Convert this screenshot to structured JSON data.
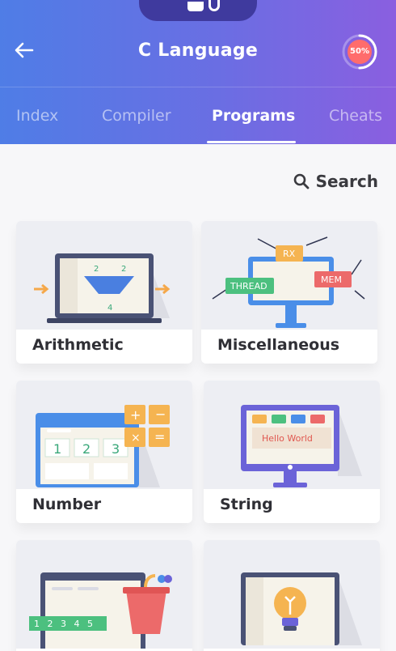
{
  "header": {
    "title": "C Language",
    "progress": {
      "value": 0.5,
      "label": "50%"
    }
  },
  "tabs": [
    {
      "label": "Index",
      "active": false
    },
    {
      "label": "Compiler",
      "active": false
    },
    {
      "label": "Programs",
      "active": true
    },
    {
      "label": "Cheats",
      "active": false
    }
  ],
  "search": {
    "label": "Search"
  },
  "cards": [
    {
      "name": "Arithmetic",
      "icon": "arithmetic-illustration",
      "art_text": [
        "2",
        "2",
        "4"
      ]
    },
    {
      "name": "Miscellaneous",
      "icon": "miscellaneous-illustration",
      "art_text": [
        "RX",
        "THREAD",
        "MEM"
      ]
    },
    {
      "name": "Number",
      "icon": "number-illustration",
      "art_text": [
        "1",
        "2",
        "3"
      ]
    },
    {
      "name": "String",
      "icon": "string-illustration",
      "art_text": [
        "Hello World"
      ]
    },
    {
      "name": "",
      "icon": "array-illustration",
      "art_text": [
        "1",
        "2",
        "3",
        "4",
        "5"
      ]
    },
    {
      "name": "",
      "icon": "idea-illustration",
      "art_text": []
    }
  ],
  "colors": {
    "header_gradient_start": "#4f7de6",
    "header_gradient_end": "#8a5fe0",
    "background": "#f7f7f9"
  }
}
